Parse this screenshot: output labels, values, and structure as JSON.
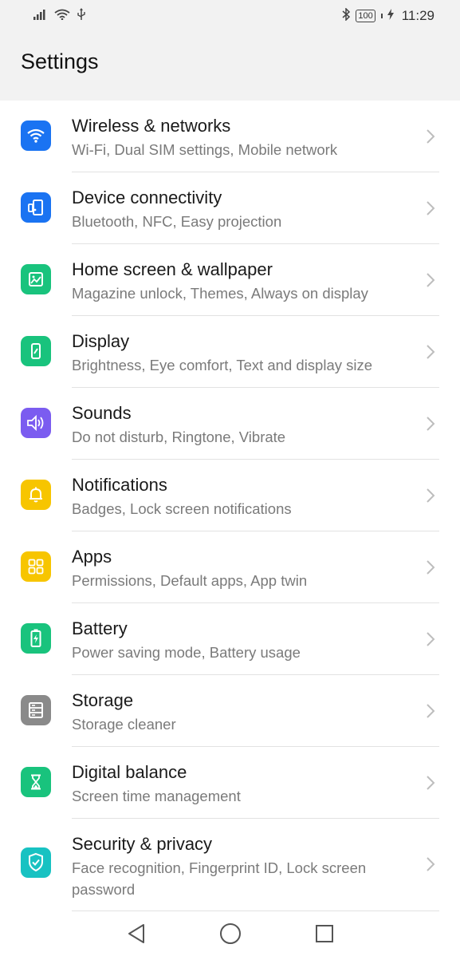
{
  "status_bar": {
    "time": "11:29",
    "battery": "100",
    "icons": [
      "signal-icon",
      "wifi-icon",
      "usb-icon",
      "bluetooth-icon",
      "battery-icon",
      "charging-icon"
    ]
  },
  "header": {
    "title": "Settings"
  },
  "settings": [
    {
      "title": "Wireless & networks",
      "subtitle": "Wi-Fi, Dual SIM settings, Mobile network",
      "icon": "wifi-icon",
      "color": "#1a73f2"
    },
    {
      "title": "Device connectivity",
      "subtitle": "Bluetooth, NFC, Easy projection",
      "icon": "device-connectivity-icon",
      "color": "#1a73f2"
    },
    {
      "title": "Home screen & wallpaper",
      "subtitle": "Magazine unlock, Themes, Always on display",
      "icon": "wallpaper-icon",
      "color": "#19c37d"
    },
    {
      "title": "Display",
      "subtitle": "Brightness, Eye comfort, Text and display size",
      "icon": "display-icon",
      "color": "#19c37d"
    },
    {
      "title": "Sounds",
      "subtitle": "Do not disturb, Ringtone, Vibrate",
      "icon": "speaker-icon",
      "color": "#7b5cf0"
    },
    {
      "title": "Notifications",
      "subtitle": "Badges, Lock screen notifications",
      "icon": "bell-icon",
      "color": "#f7c500"
    },
    {
      "title": "Apps",
      "subtitle": "Permissions, Default apps, App twin",
      "icon": "apps-grid-icon",
      "color": "#f7c500"
    },
    {
      "title": "Battery",
      "subtitle": "Power saving mode, Battery usage",
      "icon": "battery-icon",
      "color": "#19c37d"
    },
    {
      "title": "Storage",
      "subtitle": "Storage cleaner",
      "icon": "storage-icon",
      "color": "#8a8a8a"
    },
    {
      "title": "Digital balance",
      "subtitle": "Screen time management",
      "icon": "hourglass-icon",
      "color": "#19c37d"
    },
    {
      "title": "Security & privacy",
      "subtitle": "Face recognition, Fingerprint ID, Lock screen password",
      "icon": "shield-icon",
      "color": "#18c2c2"
    }
  ],
  "navbar": {
    "buttons": [
      "back-button",
      "home-button",
      "recents-button"
    ]
  }
}
